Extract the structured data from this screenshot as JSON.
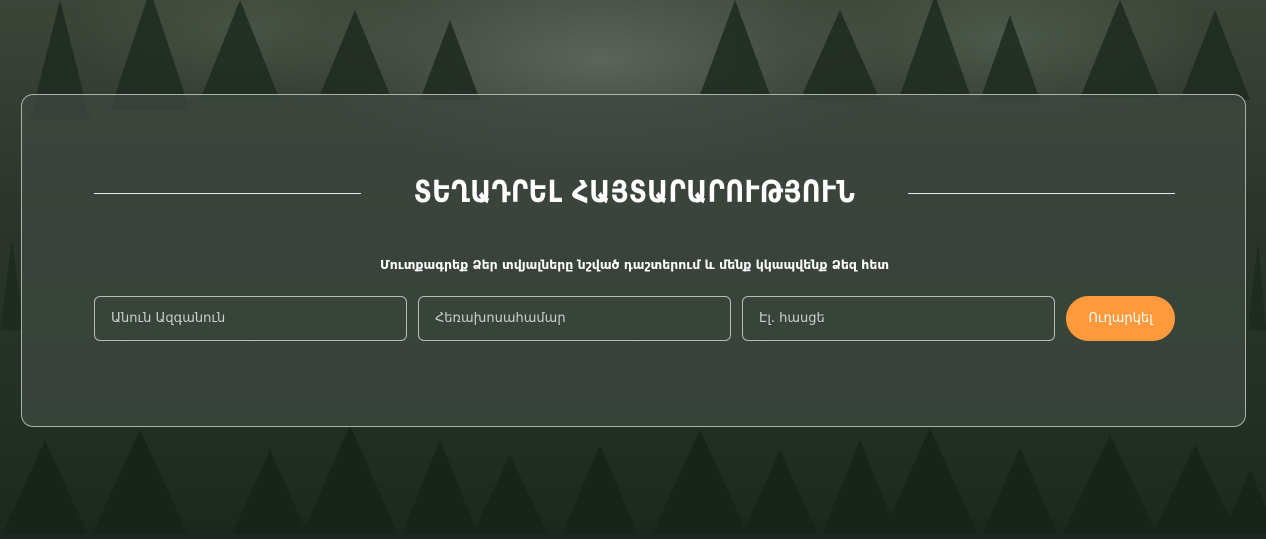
{
  "section": {
    "title": "ՏԵՂԱԴՐԵԼ ՀԱՅՏԱՐԱՐՈՒԹՅՈՒՆ",
    "subtitle": "Մուտքագրեք Ձեր տվյալները նշված դաշտերում և մենք կկապվենք Ձեզ հետ"
  },
  "form": {
    "name_placeholder": "Անուն Ազգանուն",
    "phone_placeholder": "Հեռախոսահամար",
    "email_placeholder": "Էլ. հասցե",
    "submit_label": "Ուղարկել"
  },
  "colors": {
    "accent": "#ff9a3c",
    "card_border": "#d2d7d2",
    "text": "#ffffff"
  }
}
